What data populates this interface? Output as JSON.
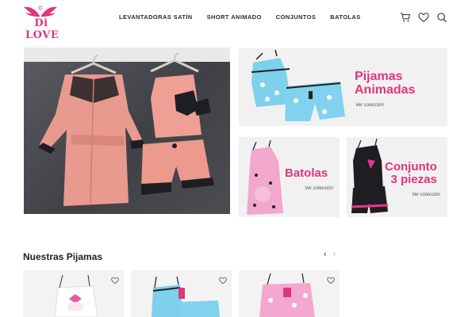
{
  "brand": {
    "logo_text": "Di LOVE",
    "accent_color": "#e0357a"
  },
  "nav": {
    "items": [
      {
        "label": "LEVANTADORAS SATÍN"
      },
      {
        "label": "SHORT ANIMADO"
      },
      {
        "label": "CONJUNTOS"
      },
      {
        "label": "BATOLAS"
      }
    ]
  },
  "header_icons": [
    "cart-icon",
    "heart-icon",
    "search-icon"
  ],
  "categories": [
    {
      "title_line1": "Pijamas",
      "title_line2": "Animadas",
      "cta": "Ver colección"
    },
    {
      "title_line1": "Batolas",
      "cta": "Ver colección"
    },
    {
      "title_line1": "Conjunto",
      "title_line2": "3 piezas",
      "cta": "Ver colección"
    }
  ],
  "products_section": {
    "title": "Nuestras Pijamas",
    "prev_icon": "chevron-left-icon",
    "next_icon": "chevron-right-icon"
  }
}
